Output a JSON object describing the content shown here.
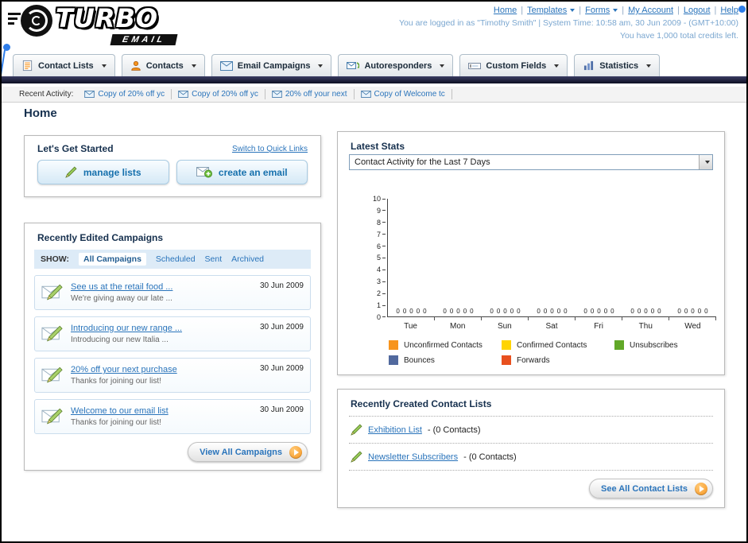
{
  "header": {
    "logo_line1": "TURBO",
    "logo_line2": "EMAIL",
    "nav_links": [
      {
        "label": "Home",
        "dropdown": false
      },
      {
        "label": "Templates",
        "dropdown": true
      },
      {
        "label": "Forms",
        "dropdown": true
      },
      {
        "label": "My Account",
        "dropdown": false
      },
      {
        "label": "Logout",
        "dropdown": false
      },
      {
        "label": "Help",
        "dropdown": false
      }
    ],
    "login_status": "You are logged in as \"Timothy Smith\" | System Time: 10:58 am, 30 Jun 2009 - (GMT+10:00)",
    "credits": "You have 1,000 total credits left."
  },
  "nav": {
    "tabs": [
      {
        "label": "Contact Lists",
        "icon": "contact-lists-icon"
      },
      {
        "label": "Contacts",
        "icon": "contacts-icon"
      },
      {
        "label": "Email Campaigns",
        "icon": "email-campaigns-icon"
      },
      {
        "label": "Autoresponders",
        "icon": "autoresponders-icon"
      },
      {
        "label": "Custom Fields",
        "icon": "custom-fields-icon"
      },
      {
        "label": "Statistics",
        "icon": "statistics-icon"
      }
    ]
  },
  "recent_activity": {
    "label": "Recent Activity:",
    "items": [
      "Copy of 20% off yc",
      "Copy of 20% off yc",
      "20% off your next",
      "Copy of Welcome tc"
    ]
  },
  "page_title": "Home",
  "get_started": {
    "title": "Let's Get Started",
    "switch_link": "Switch to Quick Links",
    "buttons": [
      {
        "label": "manage lists",
        "icon": "pencil-icon"
      },
      {
        "label": "create an email",
        "icon": "email-plus-icon"
      }
    ]
  },
  "campaigns": {
    "title": "Recently Edited Campaigns",
    "show_label": "SHOW:",
    "filters": [
      "All Campaigns",
      "Scheduled",
      "Sent",
      "Archived"
    ],
    "selected_filter": 0,
    "items": [
      {
        "title": "See us at the retail food ...",
        "subtitle": "We're giving away our late ...",
        "date": "30 Jun 2009"
      },
      {
        "title": "Introducing our new range ...",
        "subtitle": "Introducing our new Italia ...",
        "date": "30 Jun 2009"
      },
      {
        "title": "20% off your next purchase",
        "subtitle": "Thanks for joining our list!",
        "date": "30 Jun 2009"
      },
      {
        "title": "Welcome to our email list",
        "subtitle": "Thanks for joining our list!",
        "date": "30 Jun 2009"
      }
    ],
    "view_all_label": "View All Campaigns"
  },
  "stats": {
    "title": "Latest Stats",
    "dropdown_value": "Contact Activity for the Last 7 Days"
  },
  "chart_data": {
    "type": "bar",
    "title": "Contact Activity for the Last 7 Days",
    "categories": [
      "Tue",
      "Mon",
      "Sun",
      "Sat",
      "Fri",
      "Thu",
      "Wed"
    ],
    "series": [
      {
        "name": "Unconfirmed Contacts",
        "color": "#f7941d",
        "values": [
          0,
          0,
          0,
          0,
          0,
          0,
          0
        ]
      },
      {
        "name": "Confirmed Contacts",
        "color": "#ffd400",
        "values": [
          0,
          0,
          0,
          0,
          0,
          0,
          0
        ]
      },
      {
        "name": "Unsubscribes",
        "color": "#61a828",
        "values": [
          0,
          0,
          0,
          0,
          0,
          0,
          0
        ]
      },
      {
        "name": "Bounces",
        "color": "#51699e",
        "values": [
          0,
          0,
          0,
          0,
          0,
          0,
          0
        ]
      },
      {
        "name": "Forwards",
        "color": "#e8501f",
        "values": [
          0,
          0,
          0,
          0,
          0,
          0,
          0
        ]
      }
    ],
    "ylim": [
      0,
      10
    ],
    "yticks": [
      10,
      9,
      8,
      7,
      6,
      5,
      4,
      3,
      2,
      1,
      0
    ],
    "grid": false,
    "legend_position": "bottom",
    "data_labels": true
  },
  "contact_lists": {
    "title": "Recently Created Contact Lists",
    "items": [
      {
        "name": "Exhibition List",
        "detail": "- (0 Contacts)"
      },
      {
        "name": "Newsletter Subscribers",
        "detail": "- (0 Contacts)"
      }
    ],
    "see_all_label": "See All Contact Lists"
  }
}
